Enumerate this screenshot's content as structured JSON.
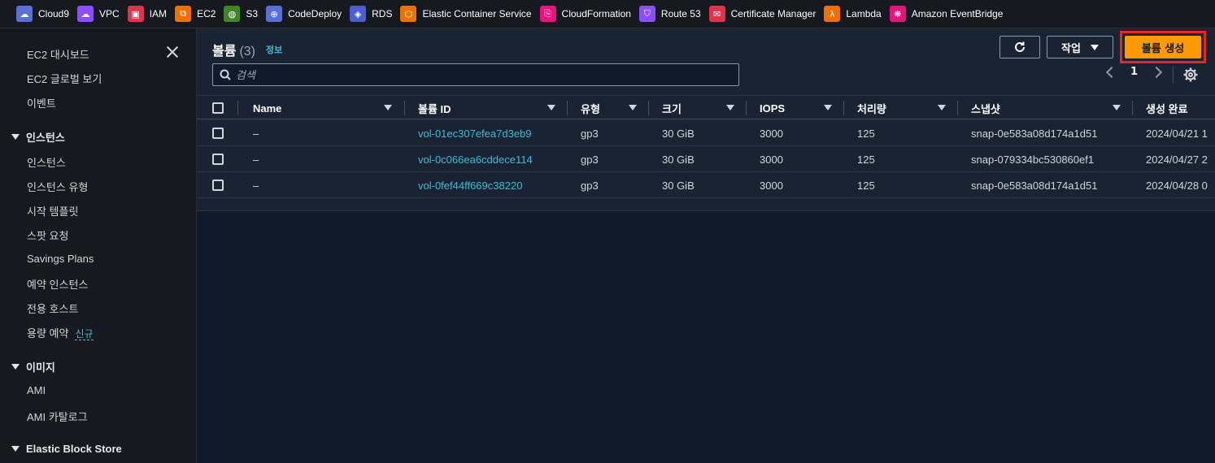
{
  "services": [
    {
      "label": "Cloud9",
      "icon": "cloud9-icon",
      "color": "#5a6fd6",
      "glyph": "☁"
    },
    {
      "label": "VPC",
      "icon": "vpc-icon",
      "color": "#8c4fff",
      "glyph": "☁"
    },
    {
      "label": "IAM",
      "icon": "iam-icon",
      "color": "#dd344c",
      "glyph": "▣"
    },
    {
      "label": "EC2",
      "icon": "ec2-icon",
      "color": "#ed7100",
      "glyph": "⧉"
    },
    {
      "label": "S3",
      "icon": "s3-icon",
      "color": "#3f8624",
      "glyph": "◍"
    },
    {
      "label": "CodeDeploy",
      "icon": "codedeploy-icon",
      "color": "#5a6fd6",
      "glyph": "⊕"
    },
    {
      "label": "RDS",
      "icon": "rds-icon",
      "color": "#4d5cd1",
      "glyph": "◈"
    },
    {
      "label": "Elastic Container Service",
      "icon": "ecs-icon",
      "color": "#ed7100",
      "glyph": "⬡"
    },
    {
      "label": "CloudFormation",
      "icon": "cloudformation-icon",
      "color": "#e7157b",
      "glyph": "⎘"
    },
    {
      "label": "Route 53",
      "icon": "route53-icon",
      "color": "#8c4fff",
      "glyph": "⛉"
    },
    {
      "label": "Certificate Manager",
      "icon": "certificate-manager-icon",
      "color": "#dd344c",
      "glyph": "✉"
    },
    {
      "label": "Lambda",
      "icon": "lambda-icon",
      "color": "#ed7100",
      "glyph": "λ"
    },
    {
      "label": "Amazon EventBridge",
      "icon": "eventbridge-icon",
      "color": "#e7157b",
      "glyph": "❋"
    }
  ],
  "sidebar": {
    "top_items": [
      "EC2 대시보드",
      "EC2 글로벌 보기",
      "이벤트"
    ],
    "instances_section": "인스턴스",
    "instances_items": [
      "인스턴스",
      "인스턴스 유형",
      "시작 템플릿",
      "스팟 요청",
      "Savings Plans",
      "예약 인스턴스",
      "전용 호스트",
      "용량 예약"
    ],
    "new_badge": "신규",
    "images_section": "이미지",
    "images_items": [
      "AMI",
      "AMI 카탈로그"
    ],
    "ebs_section": "Elastic Block Store"
  },
  "header": {
    "title": "볼륨",
    "count": "(3)",
    "info": "정보",
    "actions_label": "작업",
    "create_label": "볼륨 생성"
  },
  "search": {
    "placeholder": "검색"
  },
  "pagination": {
    "current_page": "1"
  },
  "table": {
    "columns": [
      "Name",
      "볼륨 ID",
      "유형",
      "크기",
      "IOPS",
      "처리량",
      "스냅샷",
      "생성 완료"
    ],
    "rows": [
      {
        "name": "–",
        "volume_id": "vol-01ec307efea7d3eb9",
        "type": "gp3",
        "size": "30 GiB",
        "iops": "3000",
        "throughput": "125",
        "snapshot": "snap-0e583a08d174a1d51",
        "created": "2024/04/21 1"
      },
      {
        "name": "–",
        "volume_id": "vol-0c066ea6cddece114",
        "type": "gp3",
        "size": "30 GiB",
        "iops": "3000",
        "throughput": "125",
        "snapshot": "snap-079334bc530860ef1",
        "created": "2024/04/27 2"
      },
      {
        "name": "–",
        "volume_id": "vol-0fef44ff669c38220",
        "type": "gp3",
        "size": "30 GiB",
        "iops": "3000",
        "throughput": "125",
        "snapshot": "snap-0e583a08d174a1d51",
        "created": "2024/04/28 0"
      }
    ]
  },
  "colors": {
    "accent": "#ff9900",
    "link": "#44b9d6",
    "highlight": "#e02b1f"
  }
}
